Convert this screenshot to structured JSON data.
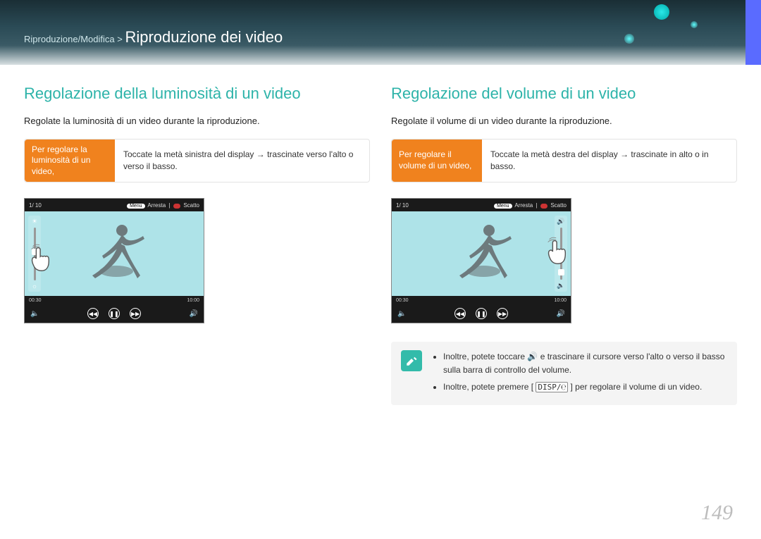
{
  "header": {
    "breadcrumb_prefix": "Riproduzione/Modifica > ",
    "breadcrumb_title": "Riproduzione dei video"
  },
  "left": {
    "title": "Regolazione della luminosità di un video",
    "desc": "Regolate la luminosità di un video durante la riproduzione.",
    "instr_label": "Per regolare la luminosità di un video,",
    "instr_text": "Toccate la metà sinistra del display → trascinate verso l'alto o verso il basso.",
    "player": {
      "counter": "1/ 10",
      "menu": "Menu",
      "stop": "Arresta",
      "shoot": "Scatto",
      "time_cur": "00:30",
      "time_dur": "10:00"
    }
  },
  "right": {
    "title": "Regolazione del volume di un video",
    "desc": "Regolate il volume di un video durante la riproduzione.",
    "instr_label": "Per regolare il volume di un video,",
    "instr_text": "Toccate la metà destra del display → trascinate in alto o in basso.",
    "player": {
      "counter": "1/ 10",
      "menu": "Menu",
      "stop": "Arresta",
      "shoot": "Scatto",
      "time_cur": "00:30",
      "time_dur": "10:00"
    },
    "note1_a": "Inoltre, potete toccare ",
    "note1_b": " e trascinare il cursore verso l'alto o verso il basso sulla barra di controllo del volume.",
    "note2_a": "Inoltre, potete premere [",
    "note2_disp": "DISP/℮",
    "note2_b": "] per regolare il volume di un video."
  },
  "page_number": "149"
}
